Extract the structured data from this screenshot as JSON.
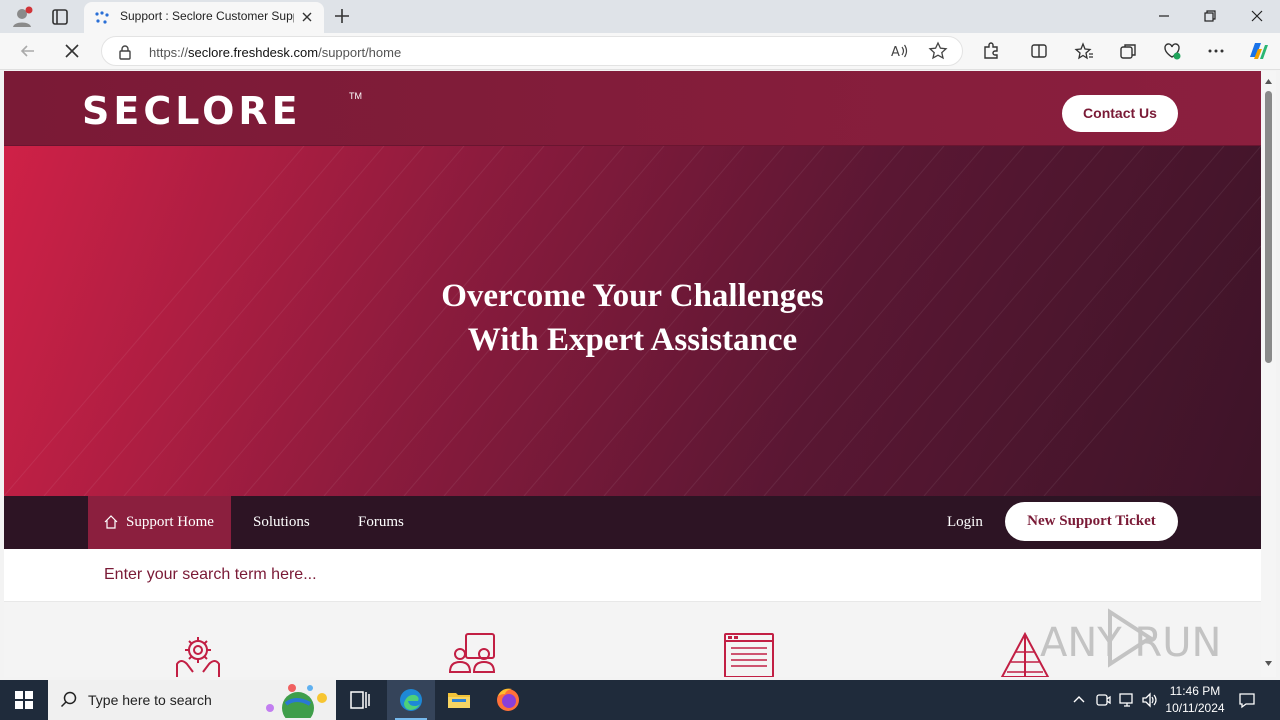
{
  "browser": {
    "tab_title": "Support : Seclore Customer Support",
    "url_prefix": "https://",
    "url_domain": "seclore.freshdesk.com",
    "url_path": "/support/home"
  },
  "page": {
    "logo": "SECLORE",
    "logo_tm": "TM",
    "contact_label": "Contact Us",
    "hero_line1": "Overcome Your Challenges",
    "hero_line2": "With Expert Assistance",
    "nav": {
      "home": "Support Home",
      "solutions": "Solutions",
      "forums": "Forums",
      "login": "Login",
      "new_ticket": "New Support Ticket"
    },
    "search_placeholder": "Enter your search term here...",
    "colors": {
      "brand": "#8b1f3e",
      "navbar": "#2d1424",
      "hero_start": "#cf2147",
      "hero_end": "#3d1428"
    }
  },
  "taskbar": {
    "search_placeholder": "Type here to search",
    "time": "11:46 PM",
    "date": "10/11/2024"
  },
  "watermark": "ANY RUN"
}
